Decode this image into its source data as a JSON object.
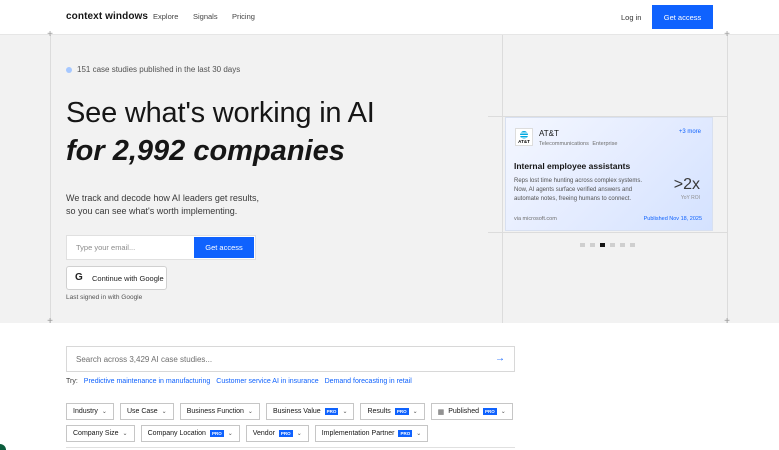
{
  "nav": {
    "brand": "context windows",
    "links": [
      "Explore",
      "Signals",
      "Pricing"
    ],
    "login": "Log in",
    "cta": "Get access"
  },
  "hero": {
    "badge": "151 case studies published in the last 30 days",
    "headline_1": "See what's working in AI",
    "headline_2": "for 2,992 companies",
    "subtitle_1": "We track and decode how AI leaders get results,",
    "subtitle_2": "so you can see what's worth implementing.",
    "email_placeholder": "Type your email...",
    "email_button": "Get access",
    "google_button": "Continue with Google",
    "last_signed": "Last signed in with Google"
  },
  "card": {
    "logo_text": "AT&T",
    "company": "AT&T",
    "tags": "Telecommunications   Enterprise",
    "more": "+3 more",
    "title": "Internal employee assistants",
    "description": "Reps lost time hunting across complex systems. Now, AI agents surface verified answers and automate notes, freeing humans to connect.",
    "metric": ">2x",
    "metric_label": "YoY ROI",
    "source": "via microsoft.com",
    "published": "Published Nov 18, 2025",
    "pagination_count": 6,
    "pagination_active": 2
  },
  "search": {
    "placeholder": "Search across 3,429 AI case studies..."
  },
  "try": {
    "label": "Try:",
    "suggestions": [
      "Predictive maintenance in manufacturing",
      "Customer service AI in insurance",
      "Demand forecasting in retail"
    ]
  },
  "filters": {
    "row1": [
      {
        "label": "Industry",
        "pro": ""
      },
      {
        "label": "Use Case",
        "pro": ""
      },
      {
        "label": "Business Function",
        "pro": ""
      },
      {
        "label": "Business Value",
        "pro": "PRO"
      },
      {
        "label": "Results",
        "pro": "PRO"
      },
      {
        "label": "Published",
        "pro": "PRO"
      }
    ],
    "row2": [
      {
        "label": "Company Size",
        "pro": ""
      },
      {
        "label": "Company Location",
        "pro": "PRO"
      },
      {
        "label": "Vendor",
        "pro": "PRO"
      },
      {
        "label": "Implementation Partner",
        "pro": "PRO"
      }
    ]
  },
  "colors": {
    "accent": "#0f62fe",
    "hero_bg": "#f2f2f2"
  }
}
